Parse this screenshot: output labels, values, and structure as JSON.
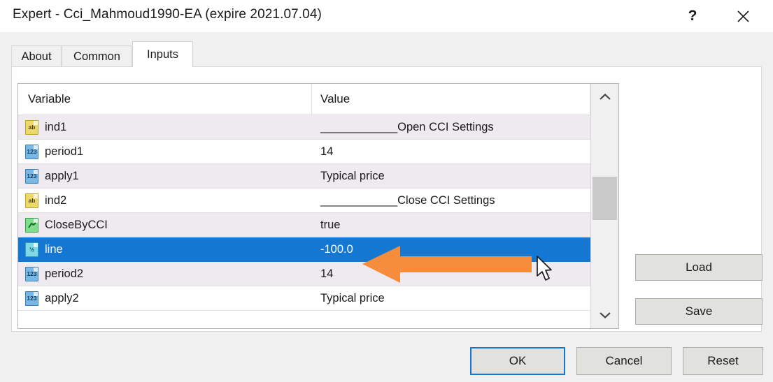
{
  "window": {
    "title": "Expert - Cci_Mahmoud1990-EA (expire 2021.07.04)",
    "help_icon": "question-mark-icon",
    "help_label": "?",
    "close_icon": "close-icon"
  },
  "tabs": [
    {
      "label": "About",
      "active": false
    },
    {
      "label": "Common",
      "active": false
    },
    {
      "label": "Inputs",
      "active": true
    }
  ],
  "table": {
    "columns": [
      "Variable",
      "Value"
    ],
    "rows": [
      {
        "name": "ind1",
        "value": "____________Open CCI Settings",
        "icon": "string-type-icon",
        "icon_label": "ab",
        "type": "string",
        "selected": false
      },
      {
        "name": "period1",
        "value": "14",
        "icon": "integer-type-icon",
        "icon_label": "123",
        "type": "int",
        "selected": false
      },
      {
        "name": "apply1",
        "value": "Typical price",
        "icon": "integer-type-icon",
        "icon_label": "123",
        "type": "int",
        "selected": false
      },
      {
        "name": "ind2",
        "value": "____________Close CCI Settings",
        "icon": "string-type-icon",
        "icon_label": "ab",
        "type": "string",
        "selected": false
      },
      {
        "name": "CloseByCCI",
        "value": "true",
        "icon": "bool-type-icon",
        "icon_label": "",
        "type": "bool",
        "selected": false
      },
      {
        "name": "line",
        "value": "-100.0",
        "icon": "double-type-icon",
        "icon_label": "½",
        "type": "double",
        "selected": true
      },
      {
        "name": "period2",
        "value": "14",
        "icon": "integer-type-icon",
        "icon_label": "123",
        "type": "int",
        "selected": false
      },
      {
        "name": "apply2",
        "value": "Typical price",
        "icon": "integer-type-icon",
        "icon_label": "123",
        "type": "int",
        "selected": false
      }
    ]
  },
  "scrollbar": {
    "up_icon": "chevron-up-icon",
    "down_icon": "chevron-down-icon"
  },
  "side_buttons": {
    "load": "Load",
    "save": "Save"
  },
  "footer_buttons": {
    "ok": "OK",
    "cancel": "Cancel",
    "reset": "Reset"
  },
  "annotation": {
    "arrow_icon": "orange-left-arrow-annotation",
    "arrow_color": "#F68D3C",
    "cursor_icon": "mouse-pointer-cursor"
  },
  "colors": {
    "selection": "#1477D2",
    "row_alt": "#EFEAEF",
    "dialog_bg": "#F0F0F0",
    "button_face": "#E1E1DE"
  }
}
